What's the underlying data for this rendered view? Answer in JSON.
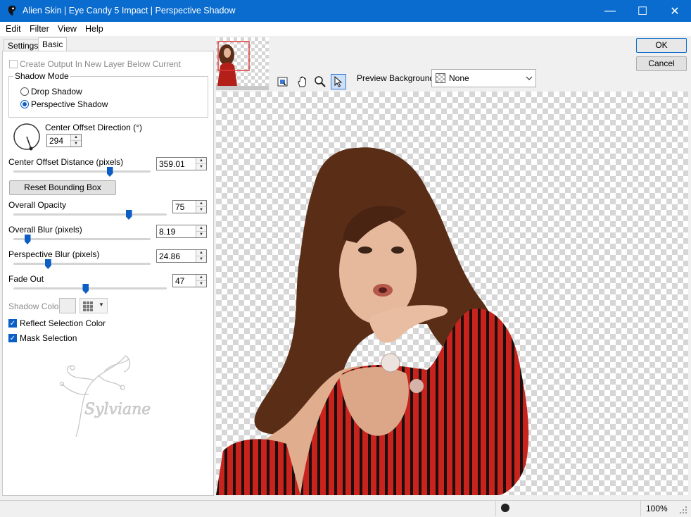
{
  "window": {
    "title": "Alien Skin | Eye Candy 5 Impact | Perspective Shadow",
    "minimize": "—",
    "maximize": "☐",
    "close": "✕"
  },
  "menu": [
    "Edit",
    "Filter",
    "View",
    "Help"
  ],
  "tabs": {
    "settings": "Settings",
    "basic": "Basic"
  },
  "options": {
    "create_output": "Create Output In New Layer Below Current",
    "shadow_mode_title": "Shadow Mode",
    "drop_shadow": "Drop Shadow",
    "perspective_shadow": "Perspective Shadow",
    "selected_mode": "Perspective Shadow"
  },
  "params": {
    "direction_label": "Center Offset Direction (°)",
    "direction_value": "294",
    "distance_label": "Center Offset Distance (pixels)",
    "distance_value": "359.01",
    "distance_level": 0.7,
    "reset_button": "Reset Bounding Box",
    "opacity_label": "Overall Opacity",
    "opacity_value": "75",
    "opacity_level": 0.75,
    "blur_label": "Overall Blur (pixels)",
    "blur_value": "8.19",
    "blur_level": 0.1,
    "pblur_label": "Perspective Blur (pixels)",
    "pblur_value": "24.86",
    "pblur_level": 0.25,
    "fade_label": "Fade Out",
    "fade_value": "47",
    "fade_level": 0.47,
    "shadow_color_label": "Shadow Color",
    "reflect_label": "Reflect Selection Color",
    "mask_label": "Mask Selection"
  },
  "watermark": "Sylviane",
  "buttons": {
    "ok": "OK",
    "cancel": "Cancel"
  },
  "preview": {
    "bg_label": "Preview Background:",
    "bg_value": "None"
  },
  "status": {
    "zoom": "100%"
  },
  "colors": {
    "accent": "#0a6cce",
    "stripe_red": "#c8231c",
    "hair": "#5a2d16"
  }
}
